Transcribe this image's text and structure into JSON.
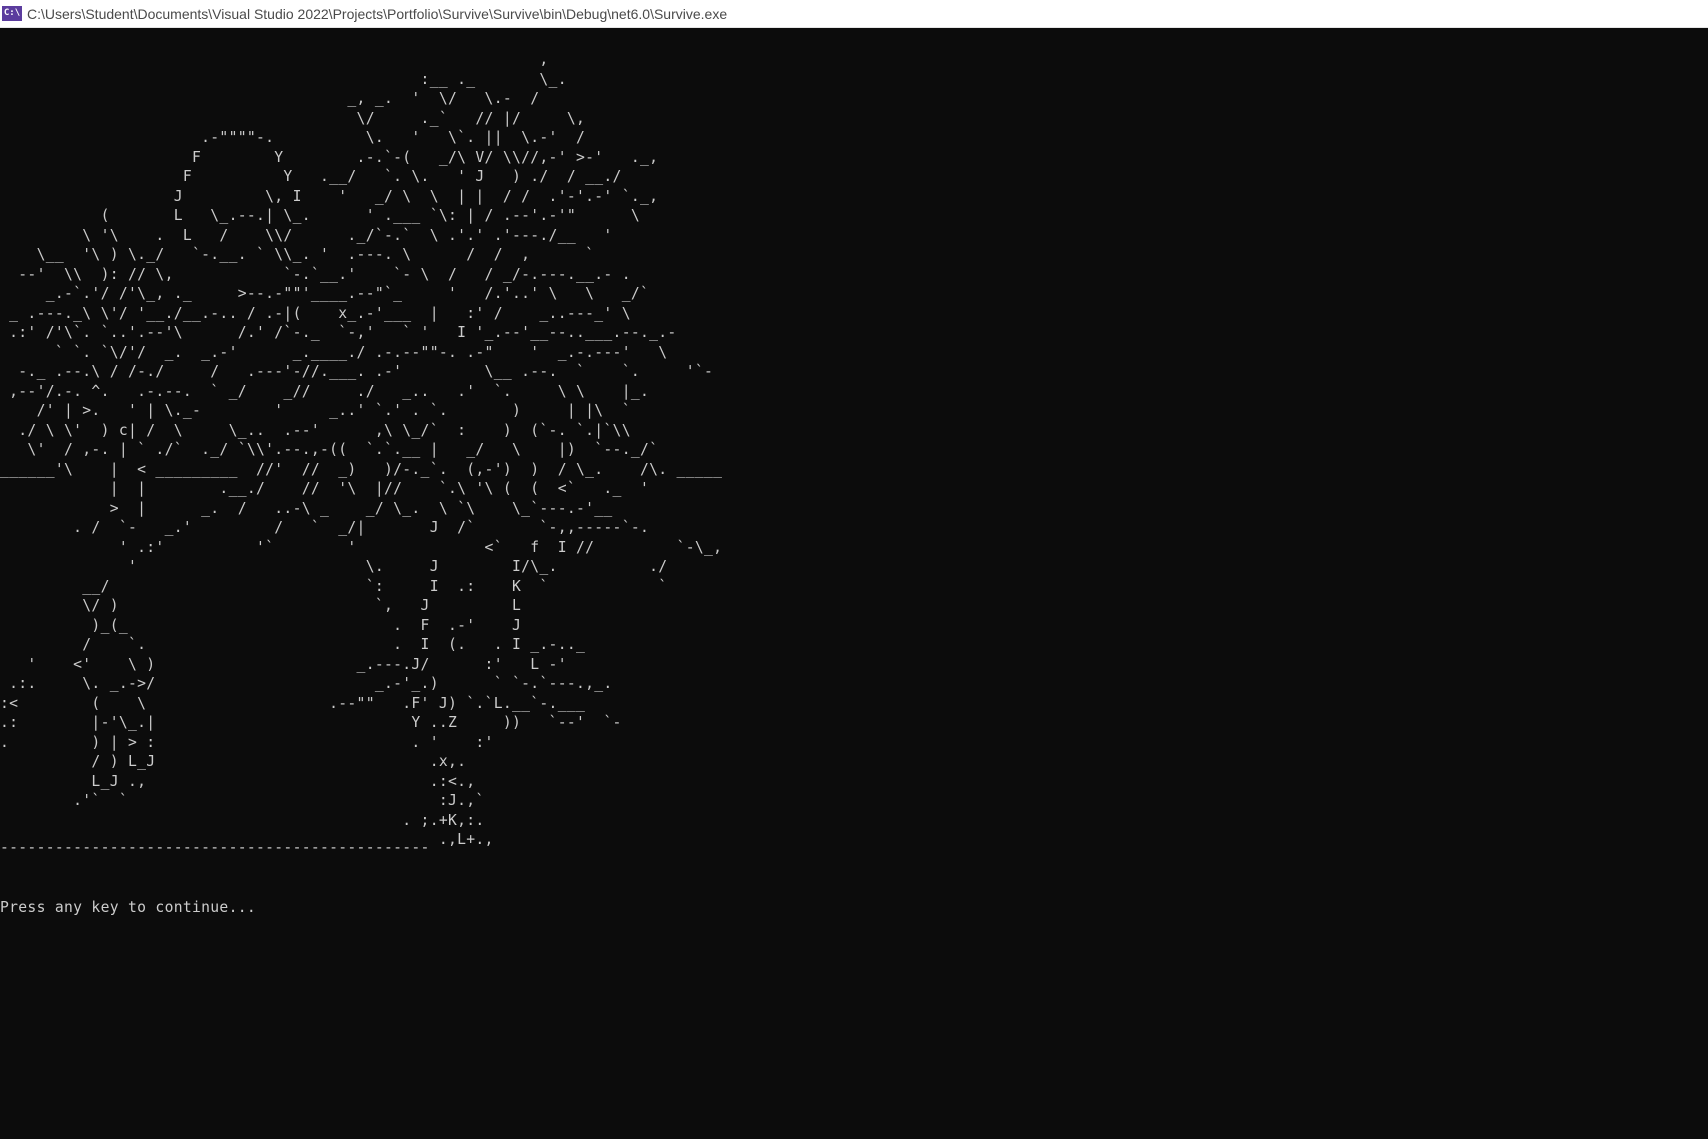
{
  "window": {
    "icon_label": "C:\\",
    "title": "C:\\Users\\Student\\Documents\\Visual Studio 2022\\Projects\\Portfolio\\Survive\\Survive\\bin\\Debug\\net6.0\\Survive.exe"
  },
  "console": {
    "ascii_art": "                                                           ,\n                                              :__ ._       \\_.\n                                      _, _.  '  \\/   \\.-  /\n                                       \\/     ._`   // |/     \\,\n                      .-\"\"\"\"-.          \\.   '   \\`. ||  \\.-'  /\n                     F        Y        .-.`-(   _/\\ V/ \\\\//,-' >-'   ._,\n                    F          Y   .__/   `. \\.   ' J   ) ./  / __./\n                   J         \\, I    '   _/ \\  \\  | |  / /  .'-'.-' `._,\n           (       L   \\_.--.| \\_.      ' .___ `\\: | / .--'.-'\"      \\\n         \\ '\\    .  L   /    \\\\/      ._/`-.`  \\ .'.' .'---./__   '\n    \\__  '\\ ) \\._/   `-.__. ` \\\\_. '  .---. \\      /  /  ,      `\n  --'  \\\\  ): // \\,            `-.`__.'    `- \\  /   / _/-.---.__.- .\n     _.-`.'/ /'\\_, ._     >--.-\"\"'____.--\"`_     '   /.'..' \\   \\   _/`\n _ .---._\\ \\'/ '__./__.-.. / .-|(    x_.-'___  |   :' /    _..---_' \\\n .:' /'\\`. `..'.--'\\      /.' /`-._  `-,'   ` '   I '_.--'__--..___.--._.-\n      ` `. `\\/'/  _.  _.-'      _.____./ .-.--\"\"-. .-\"    '  _.-.---'   \\\n  -._ .--.\\ / /-./     /   .---'-//.___. .-'         \\__ .--.  `    `.     '`-\n ,--'/.-. ^.   .-.--.  ` _/    _//     ./   _..   .'  `.     \\ \\    |_.\n    /' | >.   ' | \\._-        '     _..' `.' . `.       )     | |\\  `\n  ./ \\ \\'  ) c| /  \\     \\_..  .--'      ,\\ \\_/`  :    )  (`-. `.|`\\\\\n   \\'  / ,-. | ` ./`  ._/ `\\\\'.--.,-((  `.`.__ |   _/   \\    |)  `--._/`\n______'\\    |  < _________  //'  //  _)   )/-._`.  (,-')  )  / \\_.    /\\. _____\n            |  |        .__./    //  '\\  |//    `.\\ '\\ (  (  <`   ._  '\n            >  |      _.  /   ..-\\ _    _/ \\_.  \\ `\\    \\_`---.-'__\n        . /  `-   _.'         /   `  _/|       J  /`       `-,,-----`-.\n             ' .:'          '`        '              <`   f  I //         `-\\_,\n              '                         \\.     J        I/\\_.          ./\n         __/                            `:     I  .:    K  `            `\n         \\/ )                            `,   J         L\n          )_(_                             .  F  .-'    J\n         /    `.                           .  I  (.   . I _.-.._\n   '    <'    \\ )                      _.---.J/      :'   L -'\n .:.     \\. _.->/                        _.-'_.)      ` `-.`---.,_.\n:<        (    \\                    .--\"\"   .F' J) `.`L.__`-.___\n.:        |-'\\_.|                            Y ..Z     ))   `--'  `-\n.         ) | > :                            . '    :'\n          / ) L_J                              .x,.\n          L_J .,                               .:<.,\n        .'`  `                                  :J.,`\n                                            . ;.+K,:.\n                                                .,L+.,",
    "divider": "-----------------------------------------------",
    "prompt": "Press any key to continue..."
  },
  "colors": {
    "background": "#0c0c0c",
    "foreground": "#cccccc",
    "titlebar": "#ffffff",
    "icon": "#5b3c9e"
  }
}
